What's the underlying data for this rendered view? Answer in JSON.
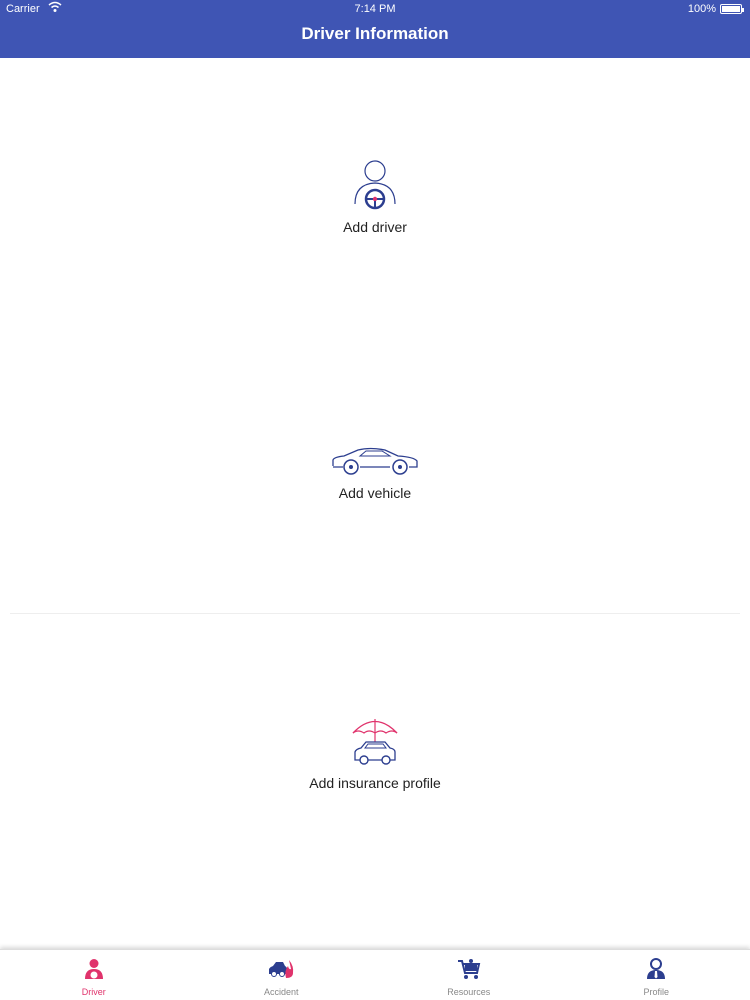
{
  "status_bar": {
    "carrier": "Carrier",
    "time": "7:14 PM",
    "battery": "100%"
  },
  "header": {
    "title": "Driver Information"
  },
  "actions": [
    {
      "label": "Add driver",
      "icon": "driver-steering-icon"
    },
    {
      "label": "Add vehicle",
      "icon": "car-icon"
    },
    {
      "label": "Add insurance profile",
      "icon": "umbrella-car-icon"
    }
  ],
  "tabbar": {
    "items": [
      {
        "label": "Driver",
        "icon": "driver-icon",
        "active": true
      },
      {
        "label": "Accident",
        "icon": "accident-icon",
        "active": false
      },
      {
        "label": "Resources",
        "icon": "cart-icon",
        "active": false
      },
      {
        "label": "Profile",
        "icon": "profile-icon",
        "active": false
      }
    ]
  },
  "colors": {
    "header": "#3f55b4",
    "accent": "#e0336c",
    "icon_stroke": "#2c3e8f"
  }
}
